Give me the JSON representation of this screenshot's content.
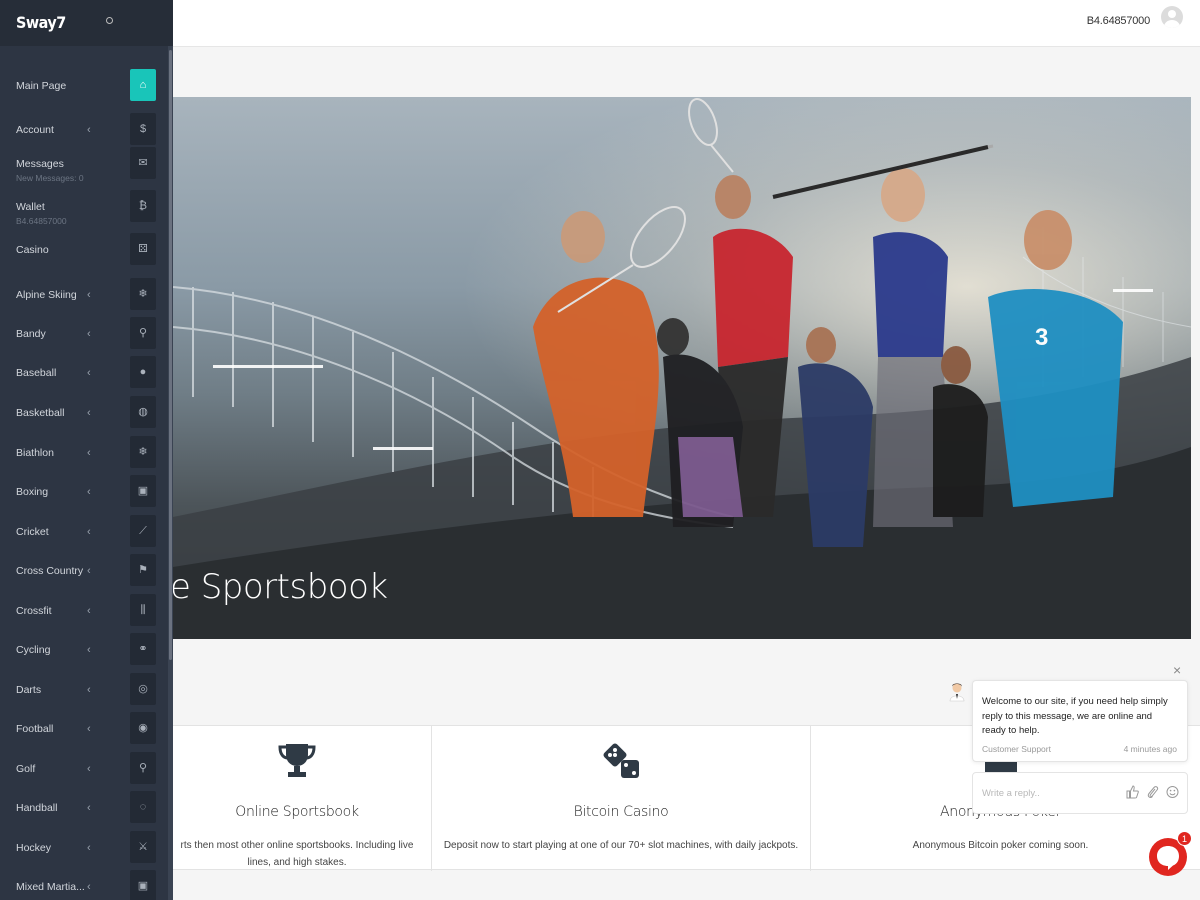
{
  "brand": {
    "name": "Sway7"
  },
  "header": {
    "balance": "B4.64857000"
  },
  "sidebar": {
    "items": [
      {
        "label": "Main Page",
        "icon": "home-icon",
        "glyph": "⌂",
        "chevron": "",
        "sub": ""
      },
      {
        "label": "Account",
        "icon": "dollar-icon",
        "glyph": "$",
        "chevron": "‹",
        "sub": ""
      },
      {
        "label": "Messages",
        "icon": "envelope-icon",
        "glyph": "✉",
        "chevron": "",
        "sub": "New Messages: 0"
      },
      {
        "label": "Wallet",
        "icon": "bitcoin-icon",
        "glyph": "₿",
        "chevron": "",
        "sub": "B4.64857000"
      },
      {
        "label": "Casino",
        "icon": "dice-icon",
        "glyph": "⚄",
        "chevron": "",
        "sub": ""
      },
      {
        "label": "Alpine Skiing",
        "icon": "snowflake-icon",
        "glyph": "❄",
        "chevron": "‹",
        "sub": ""
      },
      {
        "label": "Bandy",
        "icon": "hockey-stick-icon",
        "glyph": "⚲",
        "chevron": "‹",
        "sub": ""
      },
      {
        "label": "Baseball",
        "icon": "baseball-icon",
        "glyph": "●",
        "chevron": "‹",
        "sub": ""
      },
      {
        "label": "Basketball",
        "icon": "basketball-icon",
        "glyph": "◍",
        "chevron": "‹",
        "sub": ""
      },
      {
        "label": "Biathlon",
        "icon": "snowflake-icon",
        "glyph": "❄",
        "chevron": "‹",
        "sub": ""
      },
      {
        "label": "Boxing",
        "icon": "boxing-glove-icon",
        "glyph": "▣",
        "chevron": "‹",
        "sub": ""
      },
      {
        "label": "Cricket",
        "icon": "cricket-bat-icon",
        "glyph": "⟋",
        "chevron": "‹",
        "sub": ""
      },
      {
        "label": "Cross Country",
        "icon": "flag-icon",
        "glyph": "⚑",
        "chevron": "‹",
        "sub": ""
      },
      {
        "label": "Crossfit",
        "icon": "dumbbell-icon",
        "glyph": "⫼",
        "chevron": "‹",
        "sub": ""
      },
      {
        "label": "Cycling",
        "icon": "bicycle-icon",
        "glyph": "⚭",
        "chevron": "‹",
        "sub": ""
      },
      {
        "label": "Darts",
        "icon": "target-icon",
        "glyph": "◎",
        "chevron": "‹",
        "sub": ""
      },
      {
        "label": "Football",
        "icon": "football-icon",
        "glyph": "◉",
        "chevron": "‹",
        "sub": ""
      },
      {
        "label": "Golf",
        "icon": "golf-icon",
        "glyph": "⚲",
        "chevron": "‹",
        "sub": ""
      },
      {
        "label": "Handball",
        "icon": "handball-icon",
        "glyph": "◌",
        "chevron": "‹",
        "sub": ""
      },
      {
        "label": "Hockey",
        "icon": "hockey-icon",
        "glyph": "⚔",
        "chevron": "‹",
        "sub": ""
      },
      {
        "label": "Mixed Martia...",
        "icon": "glove-icon",
        "glyph": "▣",
        "chevron": "‹",
        "sub": ""
      }
    ]
  },
  "hero": {
    "title": "e Sportsbook"
  },
  "features": [
    {
      "title": "Online Sportsbook",
      "icon": "trophy-icon",
      "desc": "rts then most other online sportsbooks. Including live lines, and high stakes."
    },
    {
      "title": "Bitcoin Casino",
      "icon": "dice-icon",
      "desc": "Deposit now to start playing at one of our 70+ slot machines, with daily jackpots."
    },
    {
      "title": "Anonymous Poker",
      "icon": "cards-icon",
      "desc": "Anonymous Bitcoin poker coming soon."
    }
  ],
  "chat": {
    "close": "×",
    "message": "Welcome to our site, if you need help simply reply to this message, we are online and ready to help.",
    "from": "Customer Support",
    "time": "4 minutes ago",
    "placeholder": "Write a reply..",
    "badge": "1"
  }
}
